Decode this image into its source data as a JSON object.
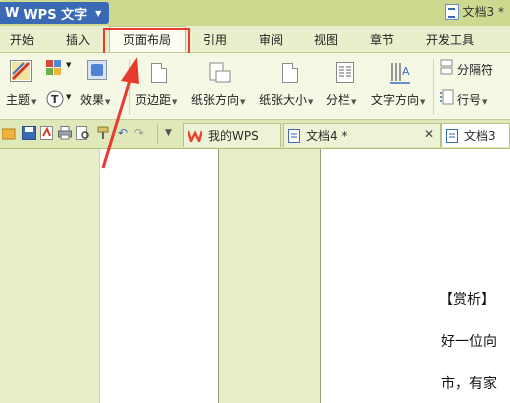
{
  "app": {
    "name": "WPS 文字",
    "logo": "W",
    "document_title": "文档3 *"
  },
  "menu": {
    "tabs": [
      "开始",
      "插入",
      "页面布局",
      "引用",
      "审阅",
      "视图",
      "章节",
      "开发工具"
    ],
    "active_tab": "页面布局"
  },
  "ribbon": {
    "theme_label": "主题",
    "effects_label": "效果",
    "margins_label": "页边距",
    "orientation_label": "纸张方向",
    "size_label": "纸张大小",
    "columns_label": "分栏",
    "text_direction_label": "文字方向",
    "breaks_label": "分隔符",
    "line_numbers_label": "行号"
  },
  "doc_tabs": [
    {
      "label": "我的WPS",
      "active": false
    },
    {
      "label": "文档4 *",
      "active": false
    },
    {
      "label": "文档3",
      "active": true
    }
  ],
  "document": {
    "lines": [
      "【赏析】",
      "好一位向",
      "市，有家"
    ]
  },
  "annotation": {
    "highlight_color": "#e83a2e",
    "target": "页面布局"
  },
  "colors": {
    "accent": "#3a69b6",
    "ribbon_bg": "#f4f8e4",
    "workspace_bg": "#e7efc8"
  }
}
